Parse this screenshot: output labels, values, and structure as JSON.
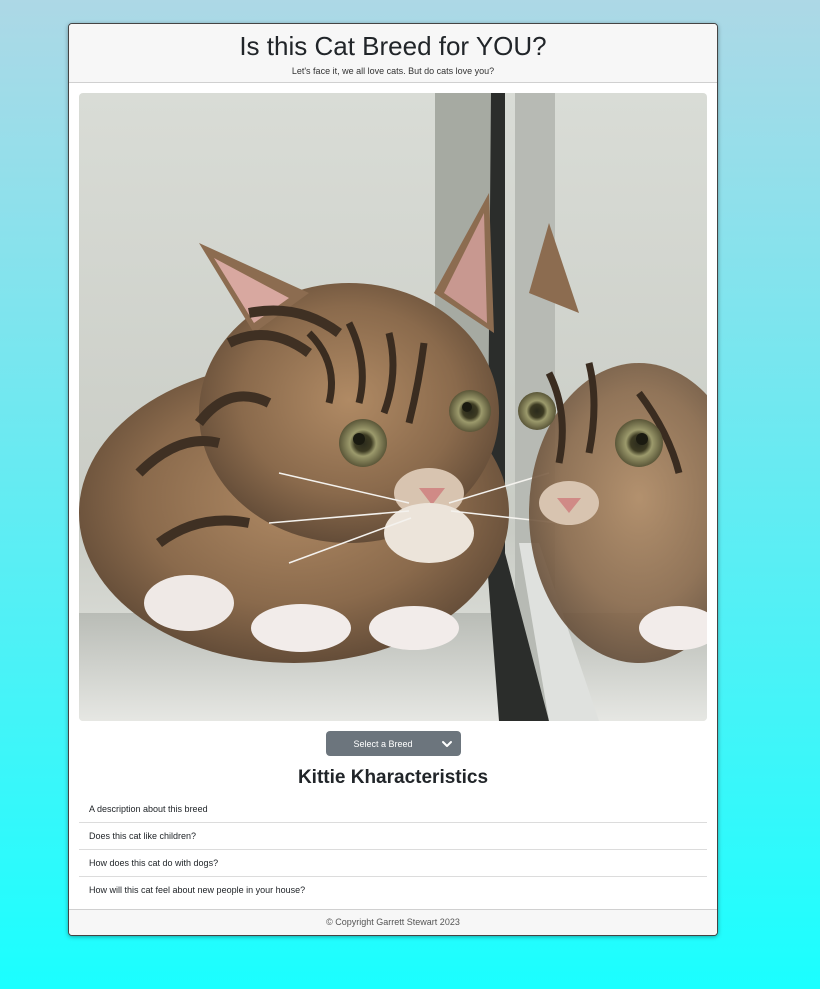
{
  "header": {
    "title": "Is this Cat Breed for YOU?",
    "subtitle": "Let's face it, we all love cats. But do cats love you?"
  },
  "image": {
    "alt": "Tabby kitten looking at its reflection in a mirror"
  },
  "selector": {
    "selected_label": "Select a Breed"
  },
  "characteristics": {
    "title": "Kittie Kharacteristics",
    "items": [
      "A description about this breed",
      "Does this cat like children?",
      "How does this cat do with dogs?",
      "How will this cat feel about new people in your house?"
    ]
  },
  "footer": {
    "copyright": "© Copyright Garrett Stewart 2023"
  },
  "colors": {
    "background_top": "#add8e6",
    "background_bottom": "#1affff",
    "select_bg": "#6c757d"
  }
}
